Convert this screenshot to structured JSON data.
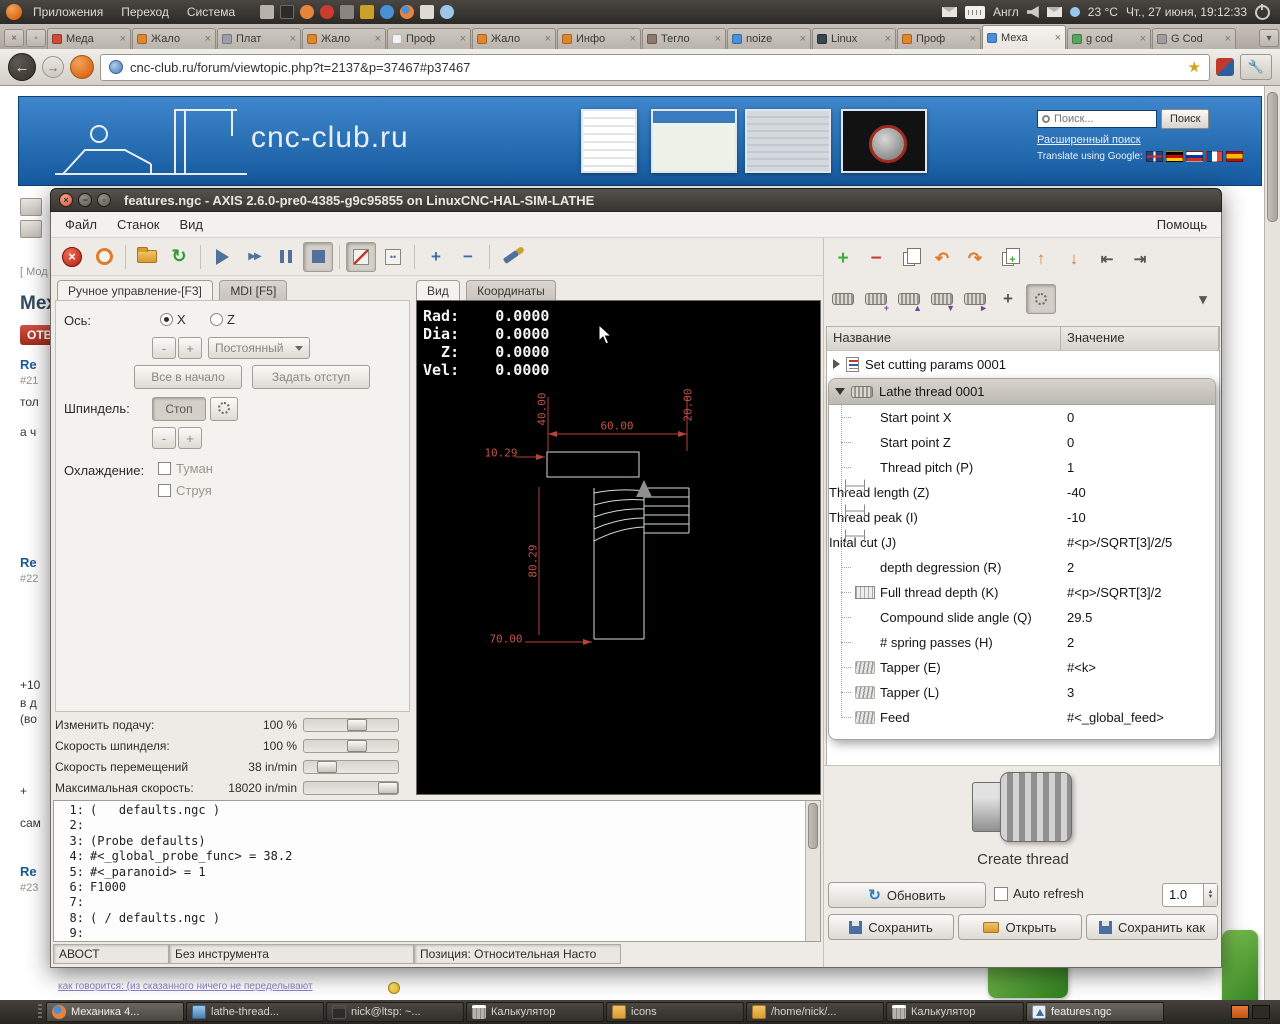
{
  "topbar": {
    "menus": [
      "Приложения",
      "Переход",
      "Система"
    ],
    "lang": "Англ",
    "temp": "23 °C",
    "clock": "Чт., 27 июня, 19:12:33"
  },
  "browser": {
    "tabs": [
      {
        "label": "Меда",
        "color": "#cf4a3c",
        "active": false
      },
      {
        "label": "Жало",
        "color": "#e0862f",
        "active": false
      },
      {
        "label": "Плат",
        "color": "#9aa0a6",
        "active": false
      },
      {
        "label": "Жало",
        "color": "#e0862f",
        "active": false
      },
      {
        "label": "Проф",
        "color": "#f2f2f2",
        "active": false
      },
      {
        "label": "Жало",
        "color": "#e0862f",
        "active": false
      },
      {
        "label": "Инфо",
        "color": "#e0862f",
        "active": false
      },
      {
        "label": "Тегло",
        "color": "#8d7a6a",
        "active": false
      },
      {
        "label": "noize",
        "color": "#4a90d9",
        "active": false
      },
      {
        "label": "Linux",
        "color": "#37474f",
        "active": false
      },
      {
        "label": "Проф",
        "color": "#e0862f",
        "active": false
      },
      {
        "label": "Меха",
        "color": "#4a90d9",
        "active": true
      },
      {
        "label": "g cod",
        "color": "#58a55c",
        "active": false
      },
      {
        "label": "G Cod",
        "color": "#9e9e9e",
        "active": false
      }
    ],
    "url": "cnc-club.ru/forum/viewtopic.php?t=2137&p=37467#p37467"
  },
  "site": {
    "logo": "cnc-club.ru",
    "search_placeholder": "Поиск...",
    "search_button": "Поиск",
    "advanced_search": "Расширенный поиск",
    "translate_label": "Translate using Google:"
  },
  "forum": {
    "fragments": [
      "Мех",
      "ОТВ",
      "Re",
      "#21",
      "тол",
      "а ч",
      "Re",
      "#22",
      "+10",
      "в д",
      "(во",
      "+",
      "сам",
      "Re",
      "#23",
      "[ Мод",
      "как говорится: (из сказанного ничего не переделывают"
    ]
  },
  "axis": {
    "title": "features.ngc - AXIS 2.6.0-pre0-4385-g9c95855 on LinuxCNC-HAL-SIM-LATHE",
    "menus": [
      "Файл",
      "Станок",
      "Вид"
    ],
    "menu_help": "Помощь",
    "manual_tab": "Ручное управление-[F3]",
    "mdi_tab": "MDI [F5]",
    "manual": {
      "axis_label": "Ось:",
      "axis_x": "X",
      "axis_z": "Z",
      "minus": "-",
      "plus": "+",
      "jog_mode": "Постоянный",
      "home_all": "Все в начало",
      "touch_off": "Задать отступ",
      "spindle_label": "Шпиндель:",
      "spindle_stop": "Стоп",
      "coolant_label": "Охлаждение:",
      "mist": "Туман",
      "flood": "Струя"
    },
    "view_tabs": [
      "Вид",
      "Координаты"
    ],
    "dro": [
      "Rad:    0.0000",
      "Dia:    0.0000",
      "  Z:    0.0000",
      "Vel:    0.0000"
    ],
    "dims": [
      "40.00",
      "60.00",
      "20.00",
      "10.29",
      "80.29",
      "70.00"
    ],
    "sliders": [
      {
        "label": "Изменить подачу:",
        "value": "100 %",
        "pos": 58
      },
      {
        "label": "Скорость шпинделя:",
        "value": "100 %",
        "pos": 58
      },
      {
        "label": "Скорость перемещений",
        "value": "38 in/min",
        "pos": 18
      },
      {
        "label": "Максимальная скорость:",
        "value": "18020 in/min",
        "pos": 100
      }
    ],
    "gcode": [
      "(   defaults.ngc )",
      "",
      "(Probe defaults)",
      "#<_global_probe_func> = 38.2",
      "#<_paranoid> = 1",
      "F1000",
      "",
      "( / defaults.ngc )",
      ""
    ],
    "status": [
      "АВОСТ",
      "Без инструмента",
      "Позиция: Относительная Насто"
    ]
  },
  "ncam": {
    "columns": [
      "Название",
      "Значение"
    ],
    "root_row": "Set cutting params 0001",
    "group_row": "Lathe thread 0001",
    "rows": [
      {
        "name": "Start point X",
        "value": "0",
        "icon": ""
      },
      {
        "name": "Start point Z",
        "value": "0",
        "icon": ""
      },
      {
        "name": "Thread pitch (P)",
        "value": "1",
        "icon": ""
      },
      {
        "name": "Thread length (Z)",
        "value": "-40",
        "icon": "dim"
      },
      {
        "name": "Thread peak (I)",
        "value": "-10",
        "icon": "dim"
      },
      {
        "name": "Inital cut (J)",
        "value": "#<p>/SQRT[3]/2/5",
        "icon": "dim"
      },
      {
        "name": "depth degression (R)",
        "value": "2",
        "icon": ""
      },
      {
        "name": "Full thread depth (K)",
        "value": "#<p>/SQRT[3]/2",
        "icon": "ruler"
      },
      {
        "name": "Compound slide angle (Q)",
        "value": "29.5",
        "icon": ""
      },
      {
        "name": "# spring passes (H)",
        "value": "2",
        "icon": ""
      },
      {
        "name": "Tapper (E)",
        "value": "#<k>",
        "icon": "spring"
      },
      {
        "name": "Tapper (L)",
        "value": "3",
        "icon": "spring"
      },
      {
        "name": "Feed",
        "value": "#<_global_feed>",
        "icon": "spring"
      }
    ],
    "create_label": "Create thread",
    "refresh_button": "Обновить",
    "auto_refresh_label": "Auto refresh",
    "refresh_interval": "1.0",
    "save_button": "Сохранить",
    "open_button": "Открыть",
    "save_as_button": "Сохранить как"
  },
  "taskbar": {
    "items": [
      {
        "label": "Механика 4...",
        "icon": "firefox",
        "active": true
      },
      {
        "label": "lathe-thread...",
        "icon": "image",
        "active": false
      },
      {
        "label": "nick@ltsp: ~...",
        "icon": "terminal",
        "active": false
      },
      {
        "label": "Калькулятор",
        "icon": "calculator",
        "active": false
      },
      {
        "label": "icons",
        "icon": "folder",
        "active": false
      },
      {
        "label": "/home/nick/...",
        "icon": "folder",
        "active": false
      },
      {
        "label": "Калькулятор",
        "icon": "calculator",
        "active": false
      },
      {
        "label": "features.ngc",
        "icon": "axis",
        "active": true
      }
    ]
  }
}
